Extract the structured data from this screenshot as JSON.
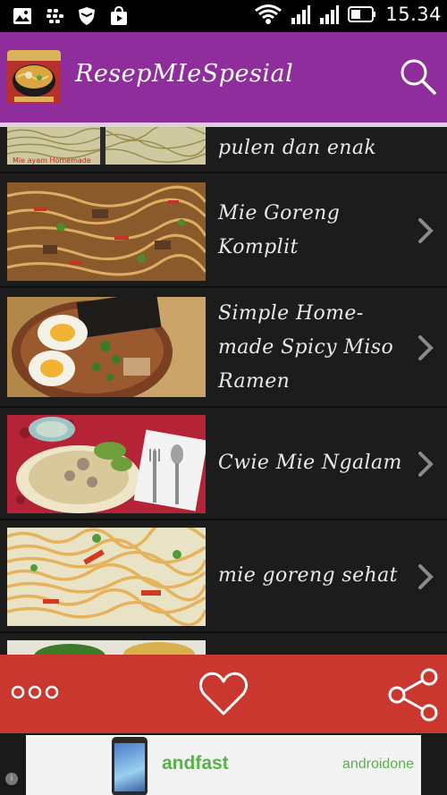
{
  "status_bar": {
    "time": "15.34",
    "icons": [
      "image-icon",
      "bbm-icon",
      "shield-icon",
      "store-icon",
      "wifi-icon",
      "signal-icon",
      "signal-2-icon",
      "battery-icon"
    ]
  },
  "app_bar": {
    "logo_icon": "noodle-bowl-logo",
    "title": "ResepMIeSpesial",
    "search_icon": "search-icon"
  },
  "list": {
    "items": [
      {
        "title": "pulen dan enak",
        "thumb": "noodles-raw"
      },
      {
        "title": "Mie Goreng Komplit",
        "thumb": "mie-goreng"
      },
      {
        "title": "Simple Home-made Spicy Miso Ramen",
        "thumb": "miso-ramen"
      },
      {
        "title": "Cwie Mie Ngalam",
        "thumb": "cwie-mie"
      },
      {
        "title": "mie goreng sehat",
        "thumb": "mie-sehat"
      }
    ]
  },
  "action_bar": {
    "more_icon": "more-dots-icon",
    "favorite_icon": "heart-icon",
    "share_icon": "share-icon"
  },
  "ad": {
    "brand_left": "andfast",
    "brand_right": "androidone"
  },
  "colors": {
    "app_bar": "#8e2d9b",
    "action_bar": "#c9372e",
    "list_bg": "#1c1c1c",
    "ad_green": "#58b24a"
  }
}
